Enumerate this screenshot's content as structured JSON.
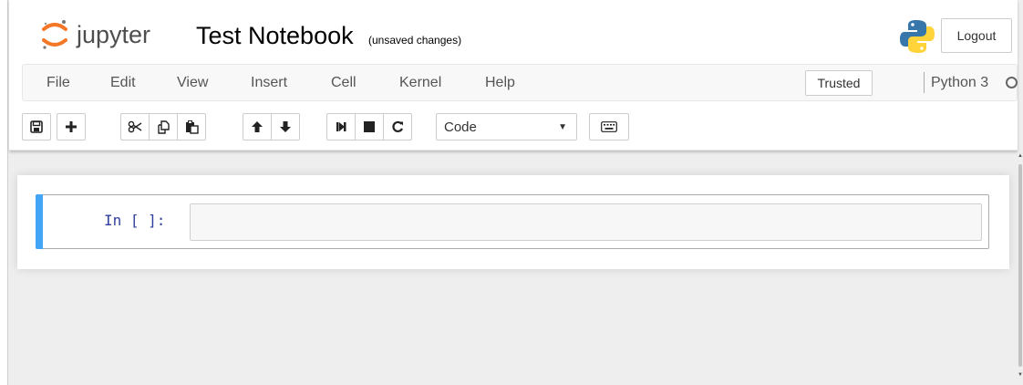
{
  "header": {
    "logo_text": "jupyter",
    "notebook_title": "Test Notebook",
    "save_status": "(unsaved changes)",
    "logout_label": "Logout"
  },
  "menubar": {
    "items": [
      "File",
      "Edit",
      "View",
      "Insert",
      "Cell",
      "Kernel",
      "Help"
    ],
    "trusted_label": "Trusted",
    "kernel_name": "Python 3"
  },
  "toolbar": {
    "buttons": [
      "save-icon",
      "plus-icon",
      "cut-icon",
      "copy-icon",
      "paste-icon",
      "arrow-up-icon",
      "arrow-down-icon",
      "run-step-icon",
      "stop-icon",
      "restart-icon",
      "keyboard-icon"
    ],
    "cell_type": "Code"
  },
  "cell": {
    "prompt": "In [ ]:"
  },
  "colors": {
    "accent_blue": "#42a5f5",
    "prompt_blue": "#303f9f",
    "logo_orange": "#f37726"
  }
}
